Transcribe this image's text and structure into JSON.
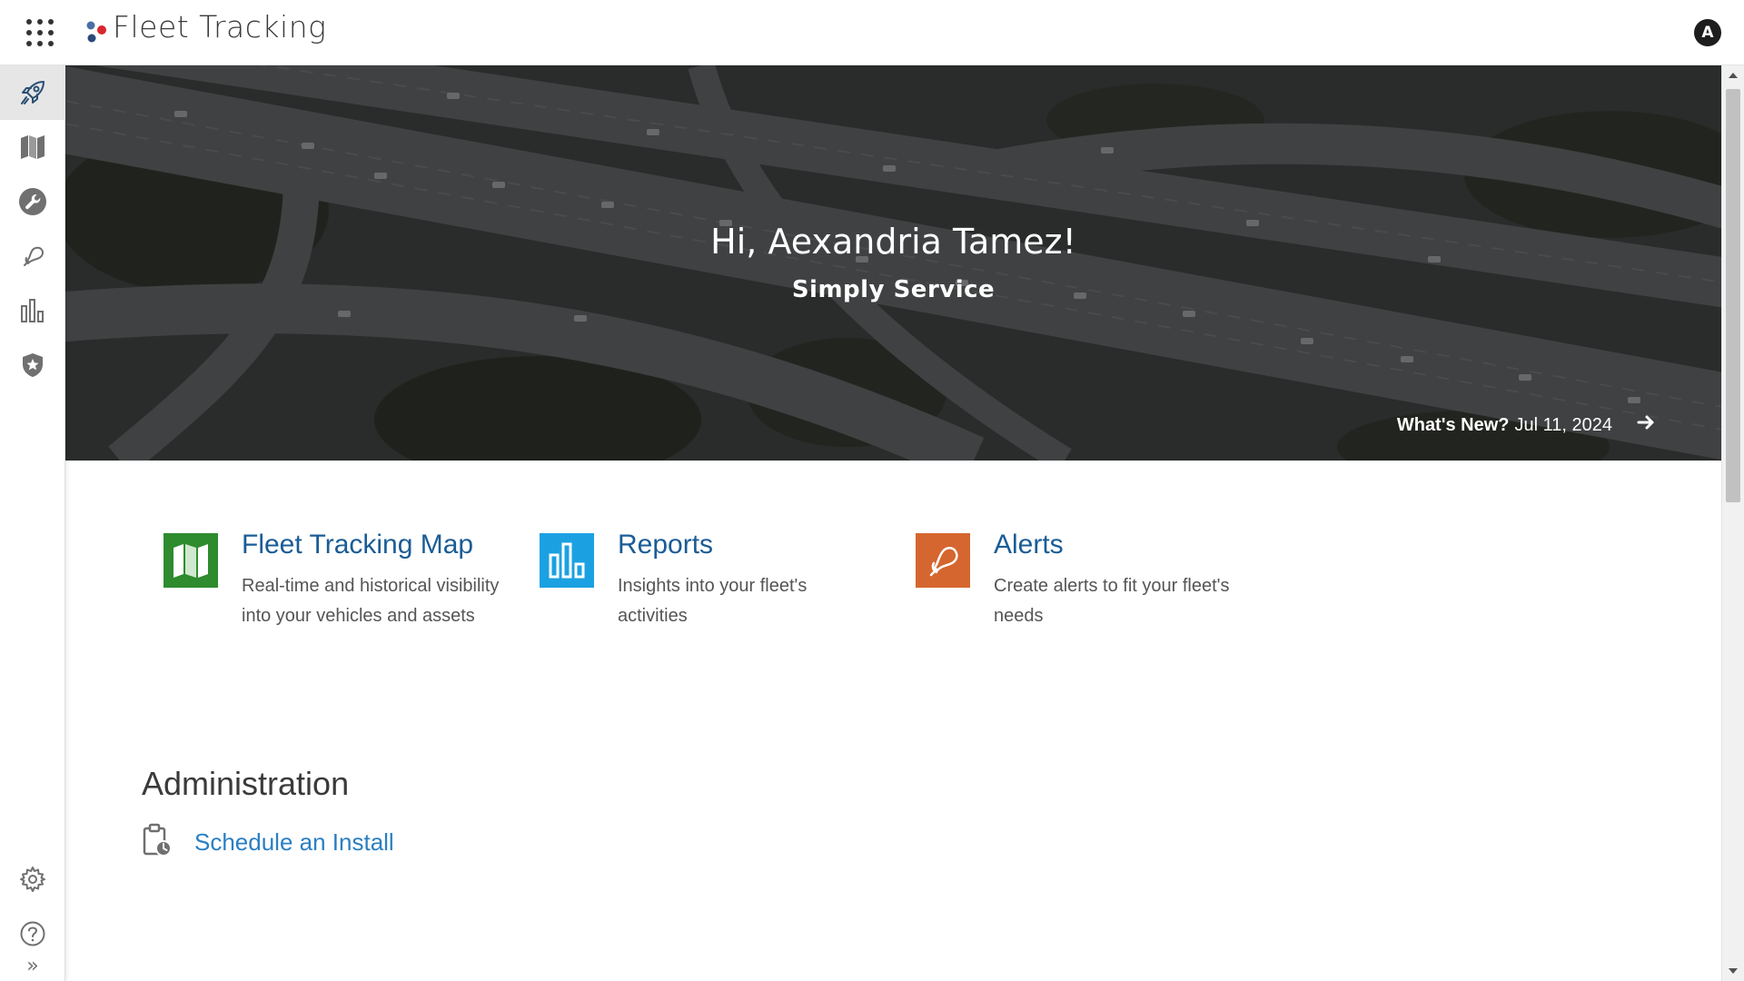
{
  "app": {
    "title": "Fleet Tracking",
    "avatar_initial": "A",
    "logo_colors": [
      "#4a6fa5",
      "#d7262e",
      "#2b4a7a"
    ]
  },
  "sidebar": {
    "top_items": [
      {
        "name": "rocket-icon",
        "active": true
      },
      {
        "name": "map-icon",
        "active": false
      },
      {
        "name": "wrench-icon",
        "active": false
      },
      {
        "name": "bell-icon",
        "active": false
      },
      {
        "name": "bar-chart-icon",
        "active": false
      },
      {
        "name": "shield-star-icon",
        "active": false
      }
    ],
    "bottom_items": [
      {
        "name": "gear-icon"
      },
      {
        "name": "help-icon"
      },
      {
        "name": "expand-icon"
      }
    ],
    "expand_glyph": "»"
  },
  "hero": {
    "greeting": "Hi, Aexandria Tamez!",
    "company": "Simply Service",
    "whats_new_label": "What's New?",
    "whats_new_date": "Jul 11, 2024"
  },
  "cards": [
    {
      "title": "Fleet Tracking Map",
      "description": "Real-time and historical visibility into your vehicles and assets",
      "icon": "map-icon",
      "color": "#2e8b2e"
    },
    {
      "title": "Reports",
      "description": "Insights into your fleet's activities",
      "icon": "bar-chart-icon",
      "color": "#1ba1e2"
    },
    {
      "title": "Alerts",
      "description": "Create alerts to fit your fleet's needs",
      "icon": "bell-icon",
      "color": "#d5662f"
    }
  ],
  "administration": {
    "heading": "Administration",
    "links": [
      {
        "label": "Schedule an Install",
        "icon": "clipboard-clock-icon"
      }
    ]
  },
  "colors": {
    "link_blue": "#1a5c96",
    "admin_link_blue": "#2a7fc3",
    "rail_icon_gray": "#707070",
    "active_icon_blue": "#2a4e73"
  }
}
